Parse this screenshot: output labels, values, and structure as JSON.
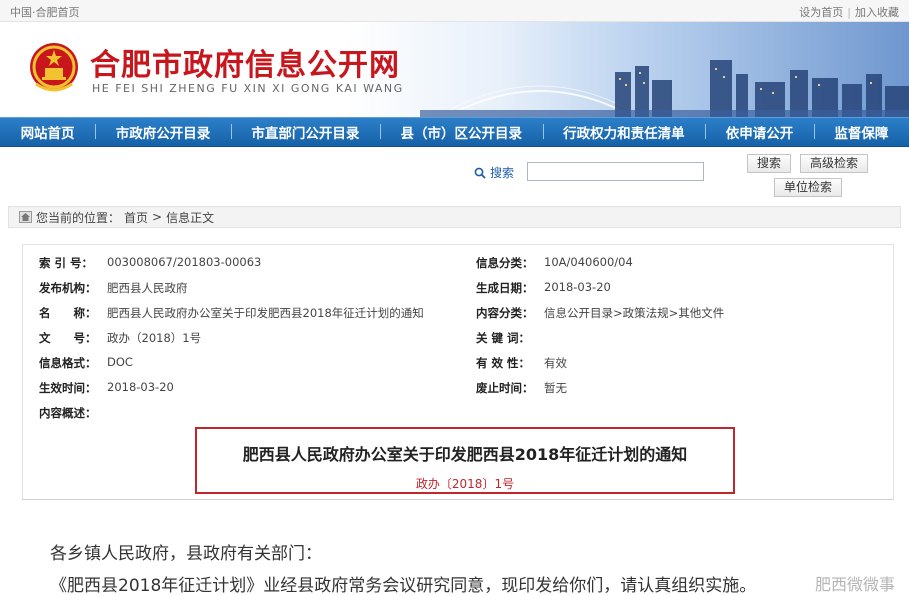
{
  "topbar": {
    "breadcrumb_left": "中国·合肥首页",
    "set_home": "设为首页",
    "divider": "|",
    "add_favorite": "加入收藏"
  },
  "header": {
    "title": "合肥市政府信息公开网",
    "pinyin": "HE FEI SHI ZHENG FU XIN XI GONG KAI WANG"
  },
  "nav": {
    "items": [
      "网站首页",
      "市政府公开目录",
      "市直部门公开目录",
      "县（市）区公开目录",
      "行政权力和责任清单",
      "依申请公开",
      "监督保障"
    ]
  },
  "search": {
    "label": "搜索",
    "placeholder": "",
    "search_button": "搜索",
    "advanced_button": "高级检索",
    "unit_button": "单位检索"
  },
  "breadcrumb": {
    "prefix": "您当前的位置：",
    "home": "首页",
    "arrow": ">",
    "current": "信息正文"
  },
  "meta": {
    "rows": [
      {
        "k1": "索 引 号：",
        "v1": "003008067/201803-00063",
        "k2": "信息分类：",
        "v2": "10A/040600/04"
      },
      {
        "k1": "发布机构：",
        "v1": "肥西县人民政府",
        "k2": "生成日期：",
        "v2": "2018-03-20"
      },
      {
        "k1": "名　　称：",
        "v1": "肥西县人民政府办公室关于印发肥西县2018年征迁计划的通知",
        "k2": "内容分类：",
        "v2": "信息公开目录>政策法规>其他文件"
      },
      {
        "k1": "文　　号：",
        "v1": "政办（2018）1号",
        "k2": "关 键 词：",
        "v2": ""
      },
      {
        "k1": "信息格式：",
        "v1": "DOC",
        "k2": "有 效 性：",
        "v2": "有效"
      },
      {
        "k1": "生效时间：",
        "v1": "2018-03-20",
        "k2": "废止时间：",
        "v2": "暂无"
      },
      {
        "k1": "内容概述：",
        "v1": "",
        "k2": "",
        "v2": ""
      }
    ]
  },
  "document": {
    "title": "肥西县人民政府办公室关于印发肥西县2018年征迁计划的通知",
    "number": "政办〔2018〕1号",
    "salutation": "各乡镇人民政府，县政府有关部门：",
    "first_line": "《肥西县2018年征迁计划》业经县政府常务会议研究同意，现印发给你们，请认真组织实施。"
  },
  "watermark": "肥西微微事"
}
